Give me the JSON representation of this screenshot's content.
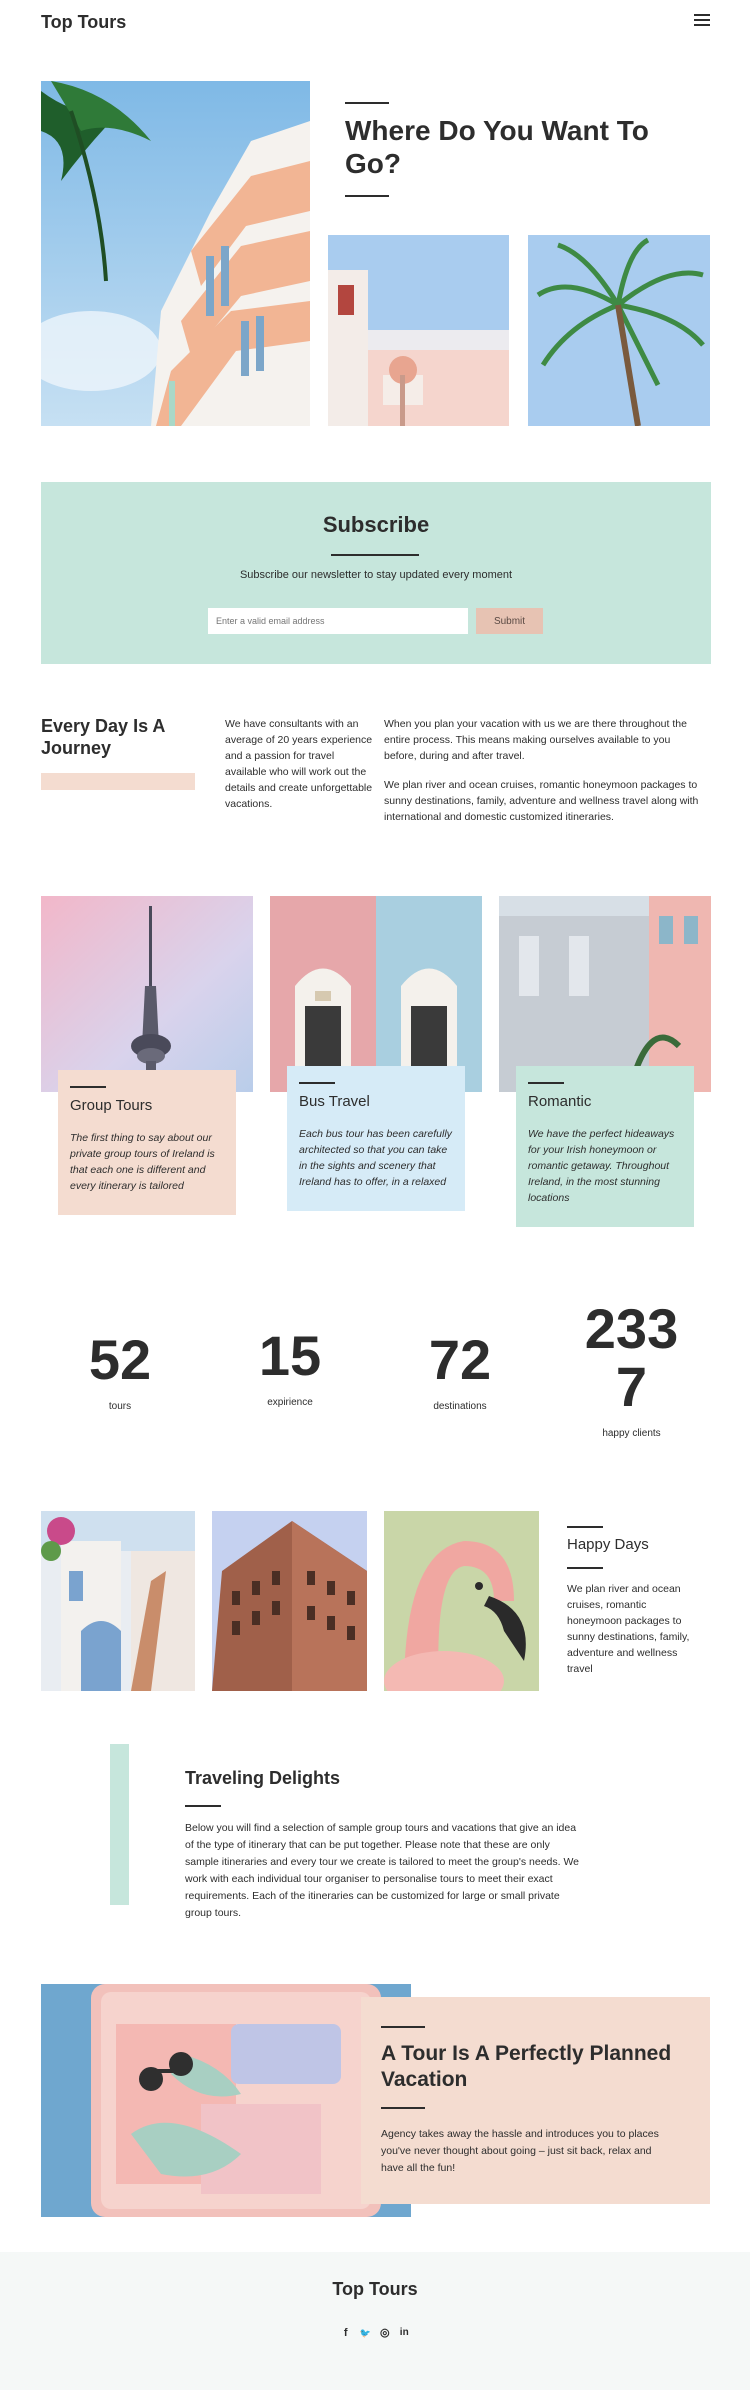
{
  "header": {
    "logo": "Top Tours",
    "menu_icon": "hamburger-menu-icon"
  },
  "hero": {
    "title": "Where Do You Want To Go?"
  },
  "subscribe": {
    "title": "Subscribe",
    "text": "Subscribe our newsletter to stay updated every moment",
    "email_placeholder": "Enter a valid email address",
    "button_label": "Submit"
  },
  "journey": {
    "title": "Every Day Is A Journey",
    "col1": "We have consultants with an average of 20 years experience and a passion for travel available who will work out the details and create unforgettable vacations.",
    "col2_p1": "When you plan your vacation with us we are there throughout the entire process. This means making ourselves available to you before, during and after travel.",
    "col2_p2": "We plan river and ocean cruises, romantic honeymoon packages to sunny destinations, family, adventure and wellness travel along with international and domestic customized itineraries."
  },
  "cards": [
    {
      "title": "Group Tours",
      "text": "The first thing to say about our private group tours of Ireland is that each one is different and every itinerary is tailored"
    },
    {
      "title": "Bus Travel",
      "text": "Each bus tour has been carefully architected so that you can take in the sights and scenery that Ireland has to offer, in a relaxed"
    },
    {
      "title": "Romantic",
      "text": "We have the perfect hideaways for your Irish honeymoon or romantic getaway. Throughout Ireland, in the most stunning locations"
    }
  ],
  "stats": [
    {
      "value": "52",
      "label": "tours"
    },
    {
      "value": "15",
      "label": "expirience"
    },
    {
      "value": "72",
      "label": "destinations"
    },
    {
      "value": "2337",
      "label": "happy clients"
    }
  ],
  "happy": {
    "title": "Happy Days",
    "text": "We plan river and ocean cruises, romantic honeymoon packages to sunny destinations, family, adventure and wellness travel"
  },
  "delights": {
    "title": "Traveling Delights",
    "text": "Below you will find a selection of sample group tours and vacations that give an idea of the type of itinerary that can be put together. Please note that these are only sample itineraries and every tour we create is tailored to meet the group's needs. We work with each individual tour organiser to personalise tours to meet their exact requirements. Each of the itineraries can be customized for large or small private group tours."
  },
  "tour": {
    "title": "A Tour Is A Perfectly Planned Vacation",
    "text": "Agency takes away the hassle and introduces you to places you've never thought about going – just sit back, relax and have all the fun!"
  },
  "footer": {
    "logo": "Top Tours",
    "socials": [
      {
        "icon": "facebook-icon",
        "glyph": "f"
      },
      {
        "icon": "twitter-icon",
        "glyph": "🐦"
      },
      {
        "icon": "instagram-icon",
        "glyph": "◎"
      },
      {
        "icon": "linkedin-icon",
        "glyph": "in"
      }
    ]
  },
  "colors": {
    "mint": "#c6e6dc",
    "peach": "#f4dcd0",
    "blue": "#d6ebf7",
    "text": "#2d2d2d"
  }
}
